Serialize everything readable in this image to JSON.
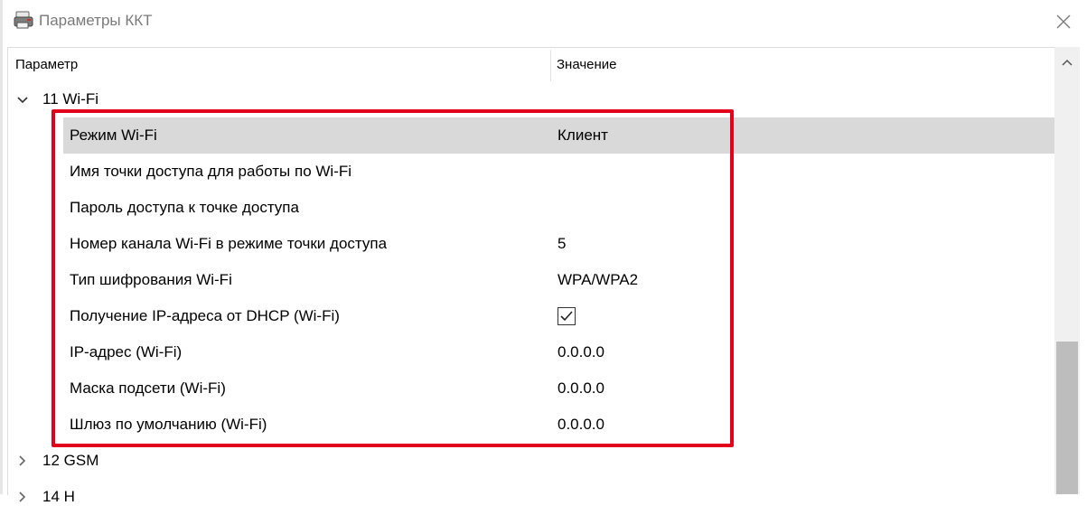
{
  "window": {
    "title": "Параметры ККТ",
    "icon": "printer-icon",
    "close_icon": "close-icon"
  },
  "table": {
    "columns": {
      "parameter": "Параметр",
      "value": "Значение"
    },
    "groups": [
      {
        "label": "11 Wi-Fi",
        "expanded": true,
        "rows": [
          {
            "label": "Режим Wi-Fi",
            "value": "Клиент",
            "selected": true
          },
          {
            "label": "Имя точки доступа для работы по Wi-Fi",
            "value": ""
          },
          {
            "label": "Пароль доступа к точке доступа",
            "value": ""
          },
          {
            "label": "Номер канала Wi-Fi в режиме точки доступа",
            "value": "5"
          },
          {
            "label": "Тип шифрования Wi-Fi",
            "value": "WPA/WPA2"
          },
          {
            "label": "Получение IP-адреса от DHCP (Wi-Fi)",
            "value": "",
            "checkbox": true,
            "checked": true
          },
          {
            "label": "IP-адрес (Wi-Fi)",
            "value": "0.0.0.0"
          },
          {
            "label": "Маска подсети (Wi-Fi)",
            "value": "0.0.0.0"
          },
          {
            "label": "Шлюз по умолчанию (Wi-Fi)",
            "value": "0.0.0.0"
          }
        ]
      },
      {
        "label": "12 GSM",
        "expanded": false
      },
      {
        "label": "14 Н",
        "expanded": false
      }
    ]
  },
  "colors": {
    "highlight": "#e3001b",
    "selected_row": "#d9d9d9",
    "scrollbar_thumb": "#bdbdbd"
  }
}
